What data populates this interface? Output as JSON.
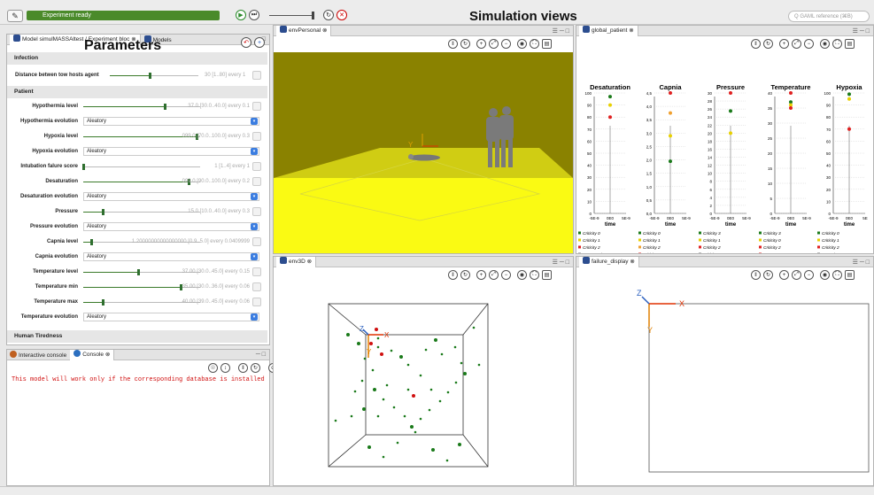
{
  "toolbar": {
    "status_text": "Experiment ready",
    "title": "Simulation views",
    "search_placeholder": "Q GAML reference (⌘B)"
  },
  "left_panel": {
    "tab_label": "Model simulMASSAltest / Experiment bloc",
    "tab2_label": "Models",
    "title": "Parameters",
    "sections": {
      "infection": "Infection",
      "patient": "Patient",
      "tiredness": "Human Tiredness"
    },
    "distance": {
      "label": "Distance betwen tow hosts agent",
      "value": "30 [1..80] every 1",
      "fraction": 0.45
    },
    "sliders": [
      {
        "label": "Hypothermia level",
        "value": "37.0 [30.0..40.0] every 0.1",
        "fraction": 0.7
      },
      {
        "label": "Hypoxia level",
        "value": "099.0 [70.0..100.0] every 0.3",
        "fraction": 0.97
      },
      {
        "label": "Intubation falure score",
        "value": "1 [1..4] every 1",
        "fraction": 0.0
      },
      {
        "label": "Desaturation",
        "value": "099.0 [90.0..100.0] every 0.2",
        "fraction": 0.9
      },
      {
        "label": "Pressure",
        "value": "15.0 [10.0..40.0] every 0.3",
        "fraction": 0.17
      },
      {
        "label": "Capnia level",
        "value": "1.20000000000000000 [0.9..5.0] every 0.0409999",
        "fraction": 0.07
      },
      {
        "label": "Temperature level",
        "value": "37.00 [30.0..45.0] every 0.15",
        "fraction": 0.47
      },
      {
        "label": "Temperature min",
        "value": "35.00 [30.0..36.0] every 0.06",
        "fraction": 0.83
      },
      {
        "label": "Temperature max",
        "value": "40.00 [39.0..45.0] every 0.06",
        "fraction": 0.17
      }
    ],
    "selects": [
      {
        "label": "Hypothermia evolution",
        "value": "Aleatory"
      },
      {
        "label": "Hypoxia evolution",
        "value": "Aleatory"
      },
      {
        "label": "Desaturation evolution",
        "value": "Aleatory"
      },
      {
        "label": "Pressure evolution",
        "value": "Aleatory"
      },
      {
        "label": "Capnia evolution",
        "value": "Aleatory"
      },
      {
        "label": "Temperature evolution",
        "value": "Aleatory"
      }
    ]
  },
  "console": {
    "tab1": "Interactive console",
    "tab2": "Console",
    "message": "This model will work only if the corresponding database is installed"
  },
  "views": {
    "env_personal": "envPersonal",
    "global_patient": "global_patient",
    "env3d": "env3D",
    "failure_display": "failure_display"
  },
  "chart_data": [
    {
      "type": "scatter",
      "title": "Desaturation",
      "xlabel": "time",
      "x_ticks": [
        "-5E-9",
        "0E0",
        "5E-9"
      ],
      "y_ticks": [
        "0",
        "10",
        "20",
        "30",
        "40",
        "50",
        "60",
        "70",
        "80",
        "90",
        "100"
      ],
      "ylim": [
        0,
        100
      ],
      "series": [
        {
          "name": "Criticity 0",
          "color": "#1a7a1a",
          "values": [
            97
          ]
        },
        {
          "name": "Criticity 1",
          "color": "#e8d000",
          "values": [
            90
          ]
        },
        {
          "name": "Criticity 2",
          "color": "#e02020",
          "values": [
            80
          ]
        }
      ]
    },
    {
      "type": "scatter",
      "title": "Capnia",
      "xlabel": "time",
      "x_ticks": [
        "-5E-9",
        "0E0",
        "5E-9"
      ],
      "y_ticks": [
        "0,0",
        "0,5",
        "1,0",
        "1,5",
        "2,0",
        "2,5",
        "3,0",
        "3,5",
        "4,0",
        "4,5"
      ],
      "ylim": [
        0,
        4.5
      ],
      "series": [
        {
          "name": "Criticity 0",
          "color": "#1a7a1a",
          "values": [
            1.95
          ]
        },
        {
          "name": "Criticity 1",
          "color": "#e8d000",
          "values": [
            2.9
          ]
        },
        {
          "name": "Criticity 2",
          "color": "#f0a030",
          "values": [
            3.75
          ]
        },
        {
          "name": "Criticity 3",
          "color": "#e02020",
          "values": [
            4.5
          ]
        }
      ]
    },
    {
      "type": "scatter",
      "title": "Pressure",
      "xlabel": "time",
      "x_ticks": [
        "-5E-9",
        "0E0",
        "5E-9"
      ],
      "y_ticks": [
        "0",
        "2",
        "4",
        "6",
        "8",
        "10",
        "12",
        "14",
        "16",
        "18",
        "20",
        "22",
        "24",
        "26",
        "28",
        "30"
      ],
      "ylim": [
        0,
        30
      ],
      "series": [
        {
          "name": "Criticity 0",
          "color": "#1a7a1a",
          "values": [
            25.5
          ]
        },
        {
          "name": "Criticity 1",
          "color": "#e8d000",
          "values": [
            20
          ]
        },
        {
          "name": "Criticity 2",
          "color": "#e02020",
          "values": [
            30
          ]
        }
      ]
    },
    {
      "type": "scatter",
      "title": "Temperature",
      "xlabel": "time",
      "x_ticks": [
        "-5E-9",
        "0E0",
        "5E-9"
      ],
      "y_ticks": [
        "0",
        "5",
        "10",
        "15",
        "20",
        "25",
        "30",
        "35",
        "40"
      ],
      "ylim": [
        0,
        40
      ],
      "series": [
        {
          "name": "Criticity 0",
          "color": "#1a7a1a",
          "values": [
            37
          ]
        },
        {
          "name": "Criticity 1",
          "color": "#e8d000",
          "values": [
            36
          ]
        },
        {
          "name": "Criticity 2",
          "color": "#e02020",
          "values": [
            35
          ]
        },
        {
          "name": "Criticity 3",
          "color": "#e02020",
          "values": [
            40
          ]
        }
      ]
    },
    {
      "type": "scatter",
      "title": "Hypoxia",
      "xlabel": "time",
      "x_ticks": [
        "-5E-9",
        "0E0",
        "5E"
      ],
      "y_ticks": [
        "0",
        "10",
        "20",
        "30",
        "40",
        "50",
        "60",
        "70",
        "80",
        "90",
        "100"
      ],
      "ylim": [
        0,
        100
      ],
      "series": [
        {
          "name": "Criticity 0",
          "color": "#1a7a1a",
          "values": [
            99
          ]
        },
        {
          "name": "Criticity 1",
          "color": "#e8d000",
          "values": [
            95
          ]
        },
        {
          "name": "Criticity 2",
          "color": "#e02020",
          "values": [
            70
          ]
        }
      ]
    }
  ],
  "legends": {
    "desaturation": [
      "Criticity 0",
      "Criticity 1",
      "Criticity 2",
      "Desaturation"
    ],
    "capnia": [
      "Criticity 0",
      "Criticity 1",
      "Criticity 2",
      "Criticity 3",
      "Capnia"
    ],
    "pressure": [
      "Criticity 3",
      "Criticity 1",
      "Criticity 2",
      "Criticity 0",
      "Pressure"
    ],
    "temperature": [
      "Criticity 3",
      "Criticity 0",
      "Criticity 2",
      "Temperature"
    ],
    "hypoxia": [
      "Criticity 0",
      "Criticity 1",
      "Criticity 2",
      "Hypoxia"
    ]
  },
  "axis_letters": {
    "x": "X",
    "y": "Y",
    "z": "Z"
  }
}
